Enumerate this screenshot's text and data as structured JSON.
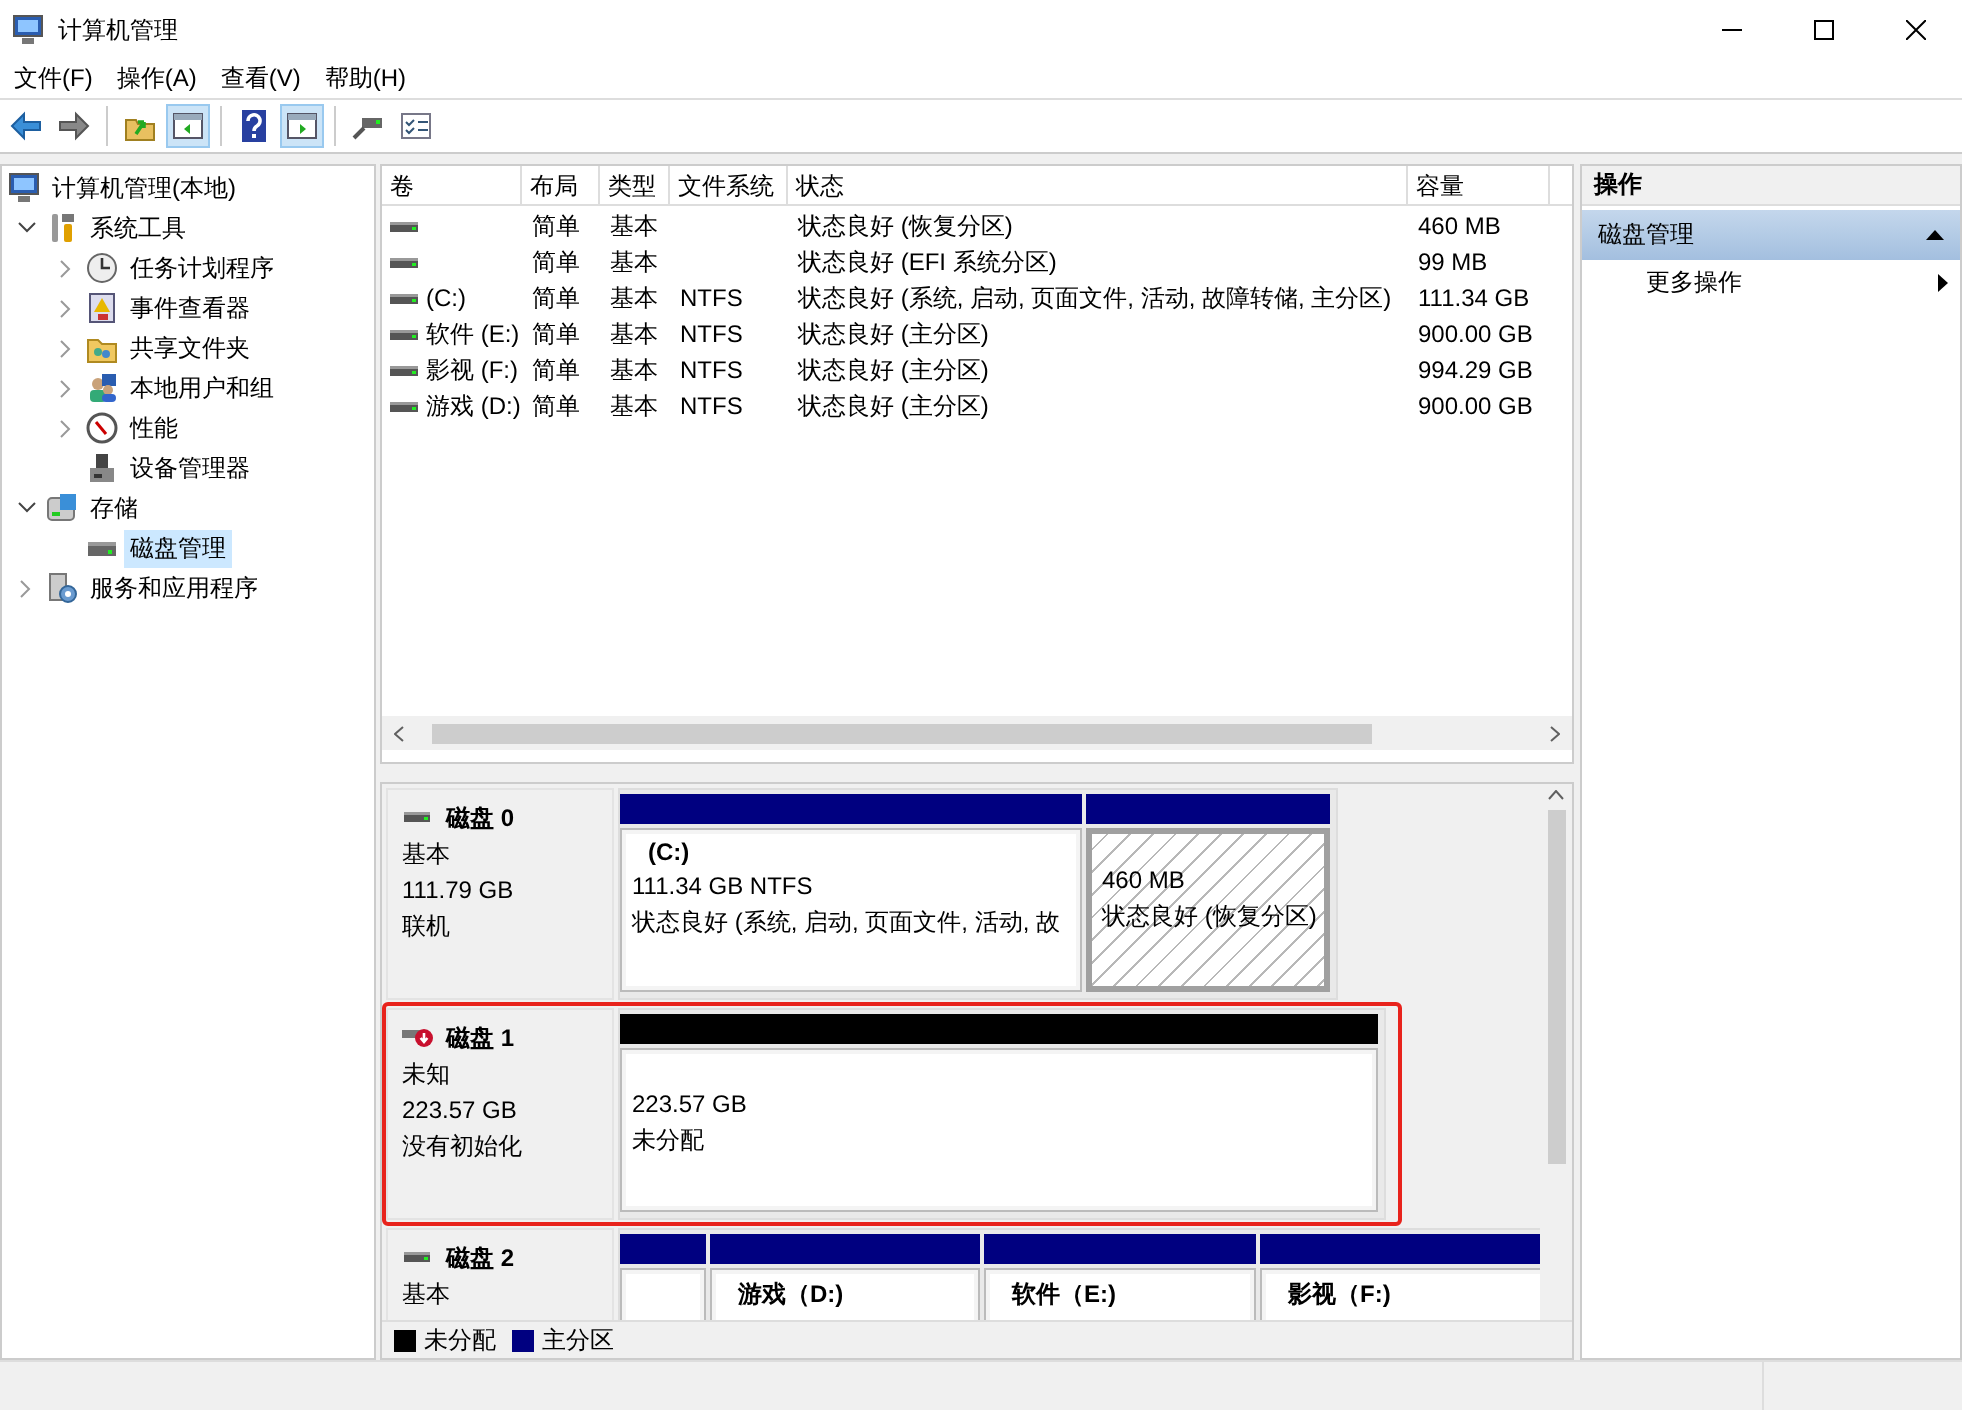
{
  "window": {
    "title": "计算机管理"
  },
  "menu": [
    "文件(F)",
    "操作(A)",
    "查看(V)",
    "帮助(H)"
  ],
  "toolbar": [
    {
      "kind": "button",
      "pressed": false
    },
    {
      "kind": "button",
      "pressed": false
    },
    {
      "kind": "separator"
    },
    {
      "kind": "button",
      "pressed": false
    },
    {
      "kind": "button",
      "pressed": true
    },
    {
      "kind": "separator"
    },
    {
      "kind": "button",
      "pressed": false
    },
    {
      "kind": "button",
      "pressed": true
    },
    {
      "kind": "separator"
    },
    {
      "kind": "button",
      "pressed": false
    },
    {
      "kind": "button",
      "pressed": false
    }
  ],
  "tree": [
    {
      "label": "计算机管理(本地)",
      "selected": false,
      "children": [
        {
          "label": "系统工具",
          "expanded": true,
          "selected": false,
          "children": [
            {
              "label": "任务计划程序",
              "expanded": false,
              "selected": false
            },
            {
              "label": "事件查看器",
              "expanded": false,
              "selected": false
            },
            {
              "label": "共享文件夹",
              "expanded": false,
              "selected": false
            },
            {
              "label": "本地用户和组",
              "expanded": false,
              "selected": false
            },
            {
              "label": "性能",
              "expanded": false,
              "selected": false
            },
            {
              "label": "设备管理器",
              "selected": false
            }
          ]
        },
        {
          "label": "存储",
          "expanded": true,
          "selected": false,
          "children": [
            {
              "label": "磁盘管理",
              "selected": true
            }
          ]
        },
        {
          "label": "服务和应用程序",
          "expanded": false,
          "selected": false
        }
      ]
    }
  ],
  "table": {
    "columns": [
      "卷",
      "布局",
      "类型",
      "文件系统",
      "状态",
      "容量"
    ],
    "rows": [
      {
        "layout": "简单",
        "type": "基本",
        "status": "状态良好 (恢复分区)",
        "capacity": "460 MB"
      },
      {
        "layout": "简单",
        "type": "基本",
        "status": "状态良好 (EFI 系统分区)",
        "capacity": "99 MB"
      },
      {
        "volume": "(C:)",
        "layout": "简单",
        "type": "基本",
        "file_system": "NTFS",
        "status": "状态良好 (系统, 启动, 页面文件, 活动, 故障转储, 主分区)",
        "capacity": "111.34 GB"
      },
      {
        "volume": "软件 (E:)",
        "layout": "简单",
        "type": "基本",
        "file_system": "NTFS",
        "status": "状态良好 (主分区)",
        "capacity": "900.00 GB"
      },
      {
        "volume": "影视 (F:)",
        "layout": "简单",
        "type": "基本",
        "file_system": "NTFS",
        "status": "状态良好 (主分区)",
        "capacity": "994.29 GB"
      },
      {
        "volume": "游戏 (D:)",
        "layout": "简单",
        "type": "基本",
        "file_system": "NTFS",
        "status": "状态良好 (主分区)",
        "capacity": "900.00 GB"
      }
    ]
  },
  "disks": [
    {
      "name": "磁盘 0",
      "type": "基本",
      "size": "111.79 GB",
      "status": "联机",
      "error": false,
      "highlighted": false,
      "partitions": [
        {
          "kind": "primary",
          "selected": false,
          "label": "(C:)",
          "detail": "111.34 GB NTFS",
          "status": "状态良好 (系统, 启动, 页面文件, 活动, 故"
        },
        {
          "kind": "primary",
          "selected": true,
          "detail": "460 MB",
          "status": "状态良好 (恢复分区)"
        }
      ]
    },
    {
      "name": "磁盘 1",
      "type": "未知",
      "size": "223.57 GB",
      "status": "没有初始化",
      "error": true,
      "highlighted": true,
      "partitions": [
        {
          "kind": "unallocated",
          "selected": false,
          "detail": "223.57 GB",
          "status": "未分配"
        }
      ]
    },
    {
      "name": "磁盘 2",
      "type": "基本",
      "error": false,
      "highlighted": false,
      "partitions": [
        {
          "kind": "primary",
          "selected": false
        },
        {
          "kind": "primary",
          "selected": false,
          "label": "游戏（D:)"
        },
        {
          "kind": "primary",
          "selected": false,
          "label": "软件（E:)"
        },
        {
          "kind": "primary",
          "selected": false,
          "label": "影视（F:)"
        }
      ]
    }
  ],
  "legend": [
    {
      "label": "未分配",
      "color": "#000000"
    },
    {
      "label": "主分区",
      "color": "#000080"
    }
  ],
  "actions": {
    "title": "操作",
    "sections": [
      {
        "title": "磁盘管理",
        "expanded": true,
        "items": [
          {
            "label": "更多操作"
          }
        ]
      }
    ]
  }
}
